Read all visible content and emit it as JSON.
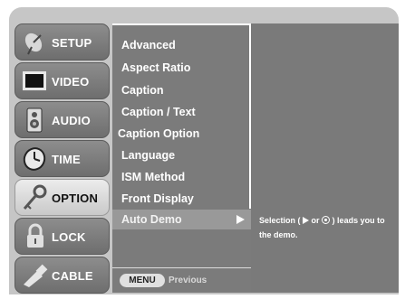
{
  "sidebar": {
    "items": [
      {
        "label": "SETUP",
        "icon": "satellite-dish-icon",
        "active": false
      },
      {
        "label": "VIDEO",
        "icon": "tv-screen-icon",
        "active": false
      },
      {
        "label": "AUDIO",
        "icon": "speaker-icon",
        "active": false
      },
      {
        "label": "TIME",
        "icon": "clock-icon",
        "active": false
      },
      {
        "label": "OPTION",
        "icon": "key-icon",
        "active": true
      },
      {
        "label": "LOCK",
        "icon": "padlock-icon",
        "active": false
      },
      {
        "label": "CABLE",
        "icon": "cable-plug-icon",
        "active": false
      }
    ]
  },
  "menu": {
    "items": [
      {
        "label": "Advanced"
      },
      {
        "label": "Aspect Ratio"
      },
      {
        "label": "Caption"
      },
      {
        "label": "Caption / Text"
      },
      {
        "label": "Caption Option"
      },
      {
        "label": "Language"
      },
      {
        "label": "ISM Method"
      },
      {
        "label": "Front Display"
      }
    ],
    "selected": {
      "label": "Auto Demo"
    },
    "footer": {
      "key_label": "MENU",
      "action_label": "Previous"
    }
  },
  "info": {
    "help_prefix": "Selection (",
    "help_middle": " or ",
    "help_suffix": ") leads you to the demo."
  },
  "colors": {
    "screen_bg": "#c6c6c6",
    "panel_bg": "#7b7b7b",
    "highlight": "#999999",
    "active_tab": "#e0e0e0"
  }
}
